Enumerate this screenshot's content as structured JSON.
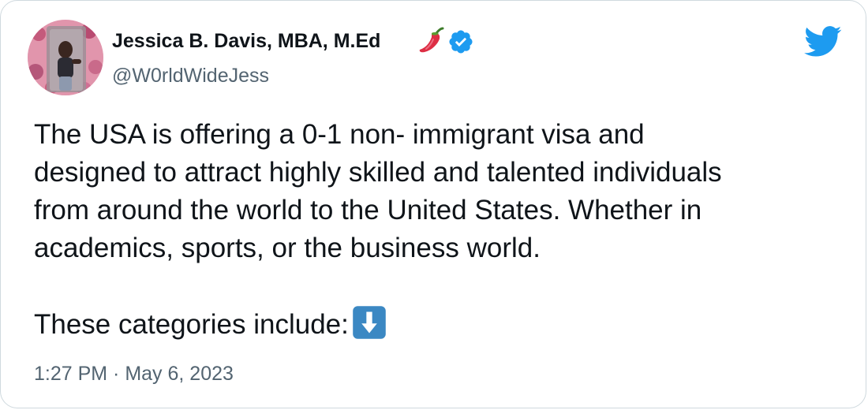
{
  "author": {
    "display_name": "Jessica B. Davis, MBA, M.Ed",
    "handle": "@W0rldWideJess",
    "avatar_icon": "profile-photo",
    "name_emoji": "hot-pepper-icon",
    "verified_icon": "verified-badge-icon"
  },
  "brand": {
    "logo_icon": "twitter-bird-icon",
    "accent_color": "#1d9bf0"
  },
  "tweet": {
    "lines": [
      "The USA is offering a 0-1 non- immigrant visa and",
      "designed to attract highly skilled and talented individuals",
      "from around the world to the United States. Whether in",
      "academics, sports, or the business world."
    ],
    "closing_line": "These categories include:",
    "closing_emoji": "down-arrow-icon"
  },
  "meta": {
    "timestamp": "1:27 PM · May 6, 2023"
  },
  "colors": {
    "text": "#0f1419",
    "secondary_text": "#536471",
    "border": "#cfd9de",
    "emoji_blue": "#3b88c3"
  }
}
